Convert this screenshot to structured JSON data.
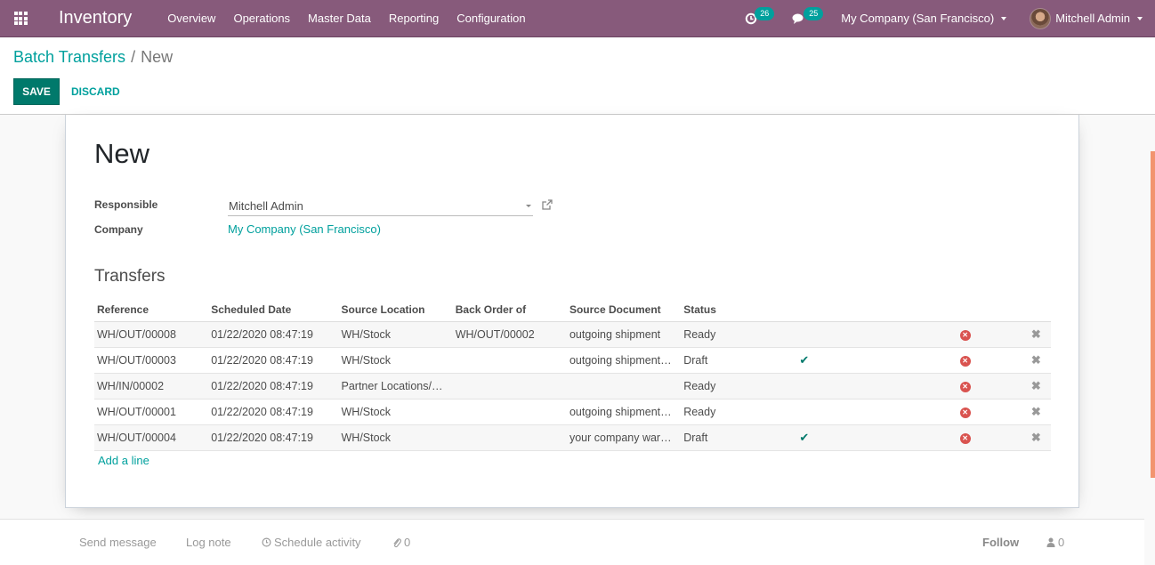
{
  "navbar": {
    "app_name": "Inventory",
    "menu": [
      "Overview",
      "Operations",
      "Master Data",
      "Reporting",
      "Configuration"
    ],
    "activity_count": "26",
    "message_count": "25",
    "company": "My Company (San Francisco)",
    "user": "Mitchell Admin",
    "accent_color": "#875a7b"
  },
  "breadcrumb": {
    "parent": "Batch Transfers",
    "separator": "/",
    "current": "New"
  },
  "toolbar": {
    "save_label": "SAVE",
    "discard_label": "DISCARD"
  },
  "form": {
    "title": "New",
    "responsible_label": "Responsible",
    "responsible_value": "Mitchell Admin",
    "company_label": "Company",
    "company_value": "My Company (San Francisco)",
    "section_title": "Transfers"
  },
  "table": {
    "columns": [
      "Reference",
      "Scheduled Date",
      "Source Location",
      "Back Order of",
      "Source Document",
      "Status"
    ],
    "rows": [
      {
        "reference": "WH/OUT/00008",
        "scheduled_date": "01/22/2020 08:47:19",
        "source_location": "WH/Stock",
        "back_order_of": "WH/OUT/00002",
        "source_document": "outgoing shipment",
        "status": "Ready",
        "show_check": false
      },
      {
        "reference": "WH/OUT/00003",
        "scheduled_date": "01/22/2020 08:47:19",
        "source_location": "WH/Stock",
        "back_order_of": "",
        "source_document": "outgoing shipment…",
        "status": "Draft",
        "show_check": true
      },
      {
        "reference": "WH/IN/00002",
        "scheduled_date": "01/22/2020 08:47:19",
        "source_location": "Partner Locations/…",
        "back_order_of": "",
        "source_document": "",
        "status": "Ready",
        "show_check": false
      },
      {
        "reference": "WH/OUT/00001",
        "scheduled_date": "01/22/2020 08:47:19",
        "source_location": "WH/Stock",
        "back_order_of": "",
        "source_document": "outgoing shipment…",
        "status": "Ready",
        "show_check": false
      },
      {
        "reference": "WH/OUT/00004",
        "scheduled_date": "01/22/2020 08:47:19",
        "source_location": "WH/Stock",
        "back_order_of": "",
        "source_document": "your company war…",
        "status": "Draft",
        "show_check": true
      }
    ],
    "add_line_label": "Add a line"
  },
  "chatter": {
    "send_message": "Send message",
    "log_note": "Log note",
    "schedule_activity": "Schedule activity",
    "attachments_count": "0",
    "follow": "Follow",
    "followers_count": "0"
  }
}
